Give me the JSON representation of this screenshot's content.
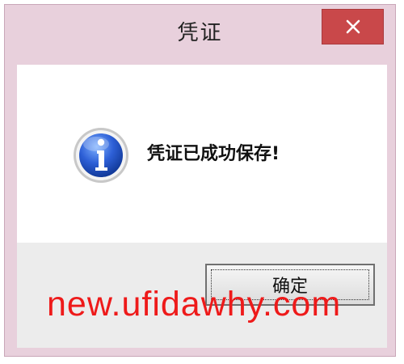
{
  "dialog": {
    "title": "凭证",
    "message": "凭证已成功保存!",
    "ok_label": "确定",
    "close_icon": "close-icon",
    "info_icon": "info-icon"
  },
  "watermark": {
    "text": "new.ufidawhy.com",
    "color": "#ee1a1a"
  },
  "colors": {
    "titlebar": "#e8d0dc",
    "close_button": "#c9484a",
    "button_area": "#ececec"
  }
}
